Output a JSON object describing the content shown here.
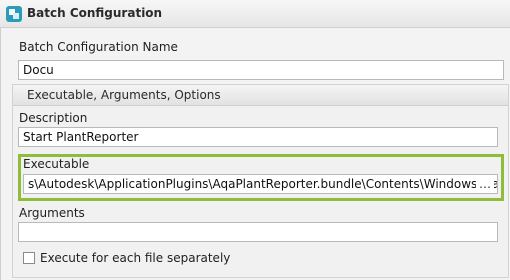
{
  "window": {
    "title": "Batch Configuration",
    "icon": "batch-config-icon",
    "accent": "#8fbd3a"
  },
  "config_name": {
    "label": "Batch Configuration Name",
    "value": "Docu"
  },
  "group": {
    "title": "Executable, Arguments, Options"
  },
  "description": {
    "label": "Description",
    "value": "Start PlantReporter"
  },
  "executable": {
    "label": "Executable",
    "value": "s\\Autodesk\\ApplicationPlugins\\AqaPlantReporter.bundle\\Contents\\Windows\\PlantReporter.exe",
    "browse_label": "…"
  },
  "arguments": {
    "label": "Arguments",
    "value": ""
  },
  "option": {
    "label": "Execute for each file separately",
    "checked": false
  }
}
